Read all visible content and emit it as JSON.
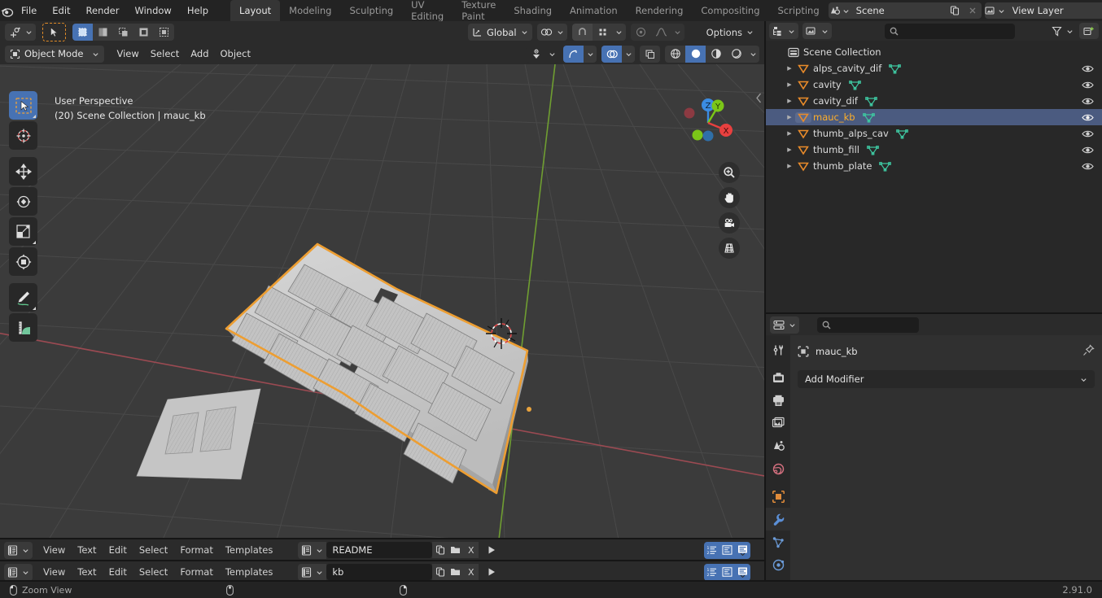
{
  "app": {
    "name": "Blender",
    "version": "2.91.0"
  },
  "topbar": {
    "logo_icon": "blender-logo-icon",
    "menus": [
      "File",
      "Edit",
      "Render",
      "Window",
      "Help"
    ],
    "workspace_tabs": [
      {
        "label": "Layout",
        "active": true
      },
      {
        "label": "Modeling",
        "active": false
      },
      {
        "label": "Sculpting",
        "active": false
      },
      {
        "label": "UV Editing",
        "active": false
      },
      {
        "label": "Texture Paint",
        "active": false
      },
      {
        "label": "Shading",
        "active": false
      },
      {
        "label": "Animation",
        "active": false
      },
      {
        "label": "Rendering",
        "active": false
      },
      {
        "label": "Compositing",
        "active": false
      },
      {
        "label": "Scripting",
        "active": false
      }
    ],
    "scene": {
      "icon": "scene-icon",
      "value": "Scene",
      "new_icon": "duplicate-icon",
      "unlink_icon": "close-icon"
    },
    "view_layer": {
      "icon": "view-layer-icon",
      "value": "View Layer",
      "new_icon": "duplicate-icon",
      "unlink_icon": "close-icon"
    }
  },
  "viewport": {
    "tool_header": {
      "cursor_tool_icon": "tool-cursor-icon",
      "tweak_icon": "tweak-select-icon",
      "select_modes": [
        "set-select-icon",
        "extend-select-icon",
        "subtract-select-icon",
        "invert-select-icon",
        "intersect-select-icon"
      ],
      "transform_orientation": "Global",
      "orientation_icon": "orientation-icon",
      "pivot_icon": "pivot-point-icon",
      "snap_icon": "snap-magnet-icon",
      "snap_target_icon": "snap-target-icon",
      "proportional_icon": "proportional-editing-icon",
      "falloff_icon": "falloff-curve-icon",
      "options_label": "Options"
    },
    "header": {
      "mode": "Object Mode",
      "mode_icon": "object-mode-icon",
      "menus": [
        "View",
        "Select",
        "Add",
        "Object"
      ],
      "visibility_icon": "object-types-visibility-icon",
      "gizmo_icon": "gizmo-icon",
      "overlays_icon": "overlays-icon",
      "xray_icon": "xray-toggle-icon",
      "shading_modes": [
        "wireframe-shading-icon",
        "solid-shading-icon",
        "material-preview-shading-icon",
        "rendered-shading-icon"
      ],
      "active_shading": "solid-shading-icon"
    },
    "overlay": {
      "perspective": "User Perspective",
      "context": "(20) Scene Collection | mauc_kb"
    },
    "toolbar": [
      {
        "name": "tool-select-box",
        "icon": "select-box-icon",
        "active": true
      },
      {
        "name": "tool-cursor",
        "icon": "cursor-icon",
        "active": false
      },
      {
        "name": "tool-move",
        "icon": "move-icon",
        "active": false
      },
      {
        "name": "tool-rotate",
        "icon": "rotate-icon",
        "active": false
      },
      {
        "name": "tool-scale",
        "icon": "scale-icon",
        "active": false
      },
      {
        "name": "tool-transform",
        "icon": "transform-icon",
        "active": false
      },
      {
        "name": "tool-annotate",
        "icon": "annotate-pencil-icon",
        "active": false
      },
      {
        "name": "tool-measure",
        "icon": "measure-ruler-icon",
        "active": false
      }
    ],
    "gizmo_axes": [
      {
        "label": "Z",
        "color": "#3b8ce2"
      },
      {
        "label": "Y",
        "color": "#7bc618"
      },
      {
        "label": "X",
        "color": "#e8403f"
      }
    ],
    "nav_buttons": [
      {
        "name": "zoom-view-button",
        "icon": "zoom-magnifier-icon"
      },
      {
        "name": "pan-view-button",
        "icon": "hand-pan-icon"
      },
      {
        "name": "camera-view-button",
        "icon": "camera-icon"
      },
      {
        "name": "toggle-perspective-button",
        "icon": "perspective-grid-icon"
      }
    ],
    "colors": {
      "background": "#3b3b3b",
      "grid": "#4c4c4c",
      "x_axis": "#9b4a52",
      "y_axis": "#70a02f",
      "selection_outline": "#ed9e32",
      "mesh_surface": "#c9c9c9"
    }
  },
  "text_editors": [
    {
      "editor_icon": "text-editor-icon",
      "menus": [
        "View",
        "Text",
        "Edit",
        "Select",
        "Format",
        "Templates"
      ],
      "datablock_icon": "text-datablock-icon",
      "filename": "README",
      "new_icon": "new-text-icon",
      "open_icon": "open-folder-icon",
      "unlink_icon": "close-x-icon",
      "run_icon": "run-script-icon",
      "toggles": [
        "line-numbers-icon",
        "word-wrap-icon",
        "syntax-highlight-icon"
      ]
    },
    {
      "editor_icon": "text-editor-icon",
      "menus": [
        "View",
        "Text",
        "Edit",
        "Select",
        "Format",
        "Templates"
      ],
      "datablock_icon": "text-datablock-icon",
      "filename": "kb",
      "new_icon": "new-text-icon",
      "open_icon": "open-folder-icon",
      "unlink_icon": "close-x-icon",
      "run_icon": "run-script-icon",
      "toggles": [
        "line-numbers-icon",
        "word-wrap-icon",
        "syntax-highlight-icon"
      ]
    }
  ],
  "outliner": {
    "display_mode_icon": "outliner-display-mode-icon",
    "filter_id_icon": "view-layer-filter-icon",
    "search_placeholder": "",
    "search_icon": "search-icon",
    "filter_icon": "filter-funnel-icon",
    "new_collection_icon": "new-collection-icon",
    "root": {
      "label": "Scene Collection",
      "icon": "scene-collection-icon"
    },
    "items": [
      {
        "label": "alps_cavity_dif",
        "icon": "mesh-object-icon",
        "data_icon": "mesh-data-icon",
        "selected": false,
        "visible": true
      },
      {
        "label": "cavity",
        "icon": "mesh-object-icon",
        "data_icon": "mesh-data-icon",
        "selected": false,
        "visible": true
      },
      {
        "label": "cavity_dif",
        "icon": "mesh-object-icon",
        "data_icon": "mesh-data-icon",
        "selected": false,
        "visible": true
      },
      {
        "label": "mauc_kb",
        "icon": "mesh-object-icon",
        "data_icon": "mesh-data-icon",
        "selected": true,
        "visible": true
      },
      {
        "label": "thumb_alps_cav",
        "icon": "mesh-object-icon",
        "data_icon": "mesh-data-icon",
        "selected": false,
        "visible": true
      },
      {
        "label": "thumb_fill",
        "icon": "mesh-object-icon",
        "data_icon": "mesh-data-icon",
        "selected": false,
        "visible": true
      },
      {
        "label": "thumb_plate",
        "icon": "mesh-object-icon",
        "data_icon": "mesh-data-icon",
        "selected": false,
        "visible": true
      }
    ]
  },
  "properties": {
    "editor_icon": "properties-editor-icon",
    "search_placeholder": "",
    "search_icon": "search-icon",
    "breadcrumb_object": "mauc_kb",
    "breadcrumb_icon": "object-icon",
    "pin_icon": "pin-icon",
    "add_modifier_label": "Add Modifier",
    "add_modifier_chevron": "chevron-down-icon",
    "tabs": [
      {
        "name": "tool-tab",
        "icon": "tool-wrench-screwdriver-icon",
        "active": false
      },
      {
        "name": "render-tab",
        "icon": "render-camera-back-icon",
        "active": false
      },
      {
        "name": "output-tab",
        "icon": "output-printer-icon",
        "active": false
      },
      {
        "name": "view-layer-tab",
        "icon": "view-layer-images-icon",
        "active": false
      },
      {
        "name": "scene-tab",
        "icon": "scene-cone-icon",
        "active": false
      },
      {
        "name": "world-tab",
        "icon": "world-globe-icon",
        "active": false
      },
      {
        "name": "object-tab",
        "icon": "object-square-icon",
        "active": false
      },
      {
        "name": "modifier-tab",
        "icon": "modifier-wrench-icon",
        "active": true
      },
      {
        "name": "particles-tab",
        "icon": "particles-icon",
        "active": false
      },
      {
        "name": "physics-tab",
        "icon": "physics-orbit-icon",
        "active": false
      }
    ]
  },
  "statusbar": {
    "items": [
      {
        "icon": "mouse-left-icon",
        "label": "Zoom View"
      },
      {
        "icon": "mouse-middle-icon",
        "label": ""
      },
      {
        "icon": "mouse-right-icon",
        "label": ""
      }
    ],
    "version": "2.91.0"
  }
}
